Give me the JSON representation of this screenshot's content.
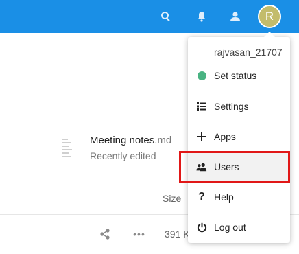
{
  "header": {
    "icons": [
      "search-icon",
      "notifications-icon",
      "contacts-icon"
    ],
    "avatar_initial": "R",
    "colors": {
      "bar": "#1a8fe6",
      "avatar": "#c3bc6b"
    }
  },
  "recent_file": {
    "name": "Meeting notes",
    "ext": ".md",
    "subtitle": "Recently edited"
  },
  "file_list": {
    "size_header": "Size",
    "row_size": "391 K"
  },
  "user_menu": {
    "username": "rajvasan_21707",
    "items": [
      {
        "label": "Set status",
        "icon": "status-dot-icon"
      },
      {
        "label": "Settings",
        "icon": "settings-list-icon"
      },
      {
        "label": "Apps",
        "icon": "plus-icon"
      },
      {
        "label": "Users",
        "icon": "users-icon"
      },
      {
        "label": "Help",
        "icon": "help-icon"
      },
      {
        "label": "Log out",
        "icon": "power-icon"
      }
    ],
    "highlight_color": "#e11717",
    "status_color": "#49b382"
  }
}
